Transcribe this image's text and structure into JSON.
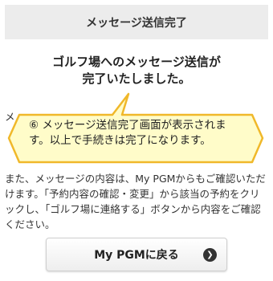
{
  "header": {
    "title": "メッセージ送信完了"
  },
  "main": {
    "heading_line1": "ゴルフ場へのメッセージ送信が",
    "heading_line2": "完了いたしました。",
    "para1_start": "メ",
    "para2": "また、メッセージの内容は、My PGMからもご確認いただけます。「予約内容の確認・変更」から該当の予約をクリックし、「ゴルフ場に連絡する」ボタンから内容をご確認ください。"
  },
  "callout": {
    "text": "⑥ メッセージ送信完了画面が表示されます。以上で手続きは完了になります。"
  },
  "button": {
    "label": "My PGMに戻る",
    "arrow": "❯"
  },
  "colors": {
    "callout_fill": "#fffcc9",
    "callout_border": "#f0b82a",
    "header_bg": "#ececec"
  },
  "icons": {
    "button_arrow": "chevron-right-circle-icon"
  }
}
